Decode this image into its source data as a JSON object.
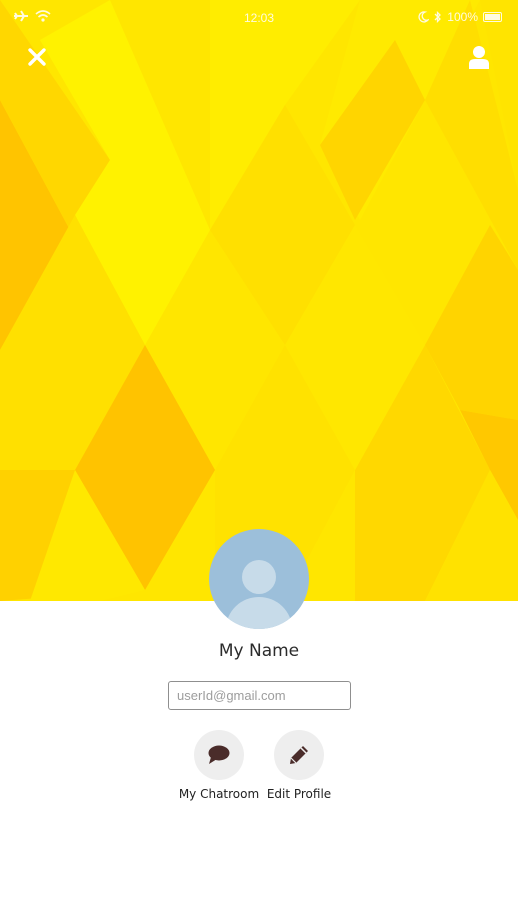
{
  "statusbar": {
    "time": "12:03",
    "battery": "100%"
  },
  "header": {
    "close_icon": "close-icon",
    "profile_icon": "user-icon"
  },
  "profile": {
    "name": "My Name",
    "email_placeholder": "userId@gmail.com"
  },
  "actions": [
    {
      "label": "My Chatroom",
      "icon": "chat-bubble-icon"
    },
    {
      "label": "Edit Profile",
      "icon": "pencil-icon"
    }
  ],
  "colors": {
    "hero_yellow": "#ffe600",
    "avatar_bg": "#9cbfda",
    "icon_dark": "#4a2c2a"
  }
}
